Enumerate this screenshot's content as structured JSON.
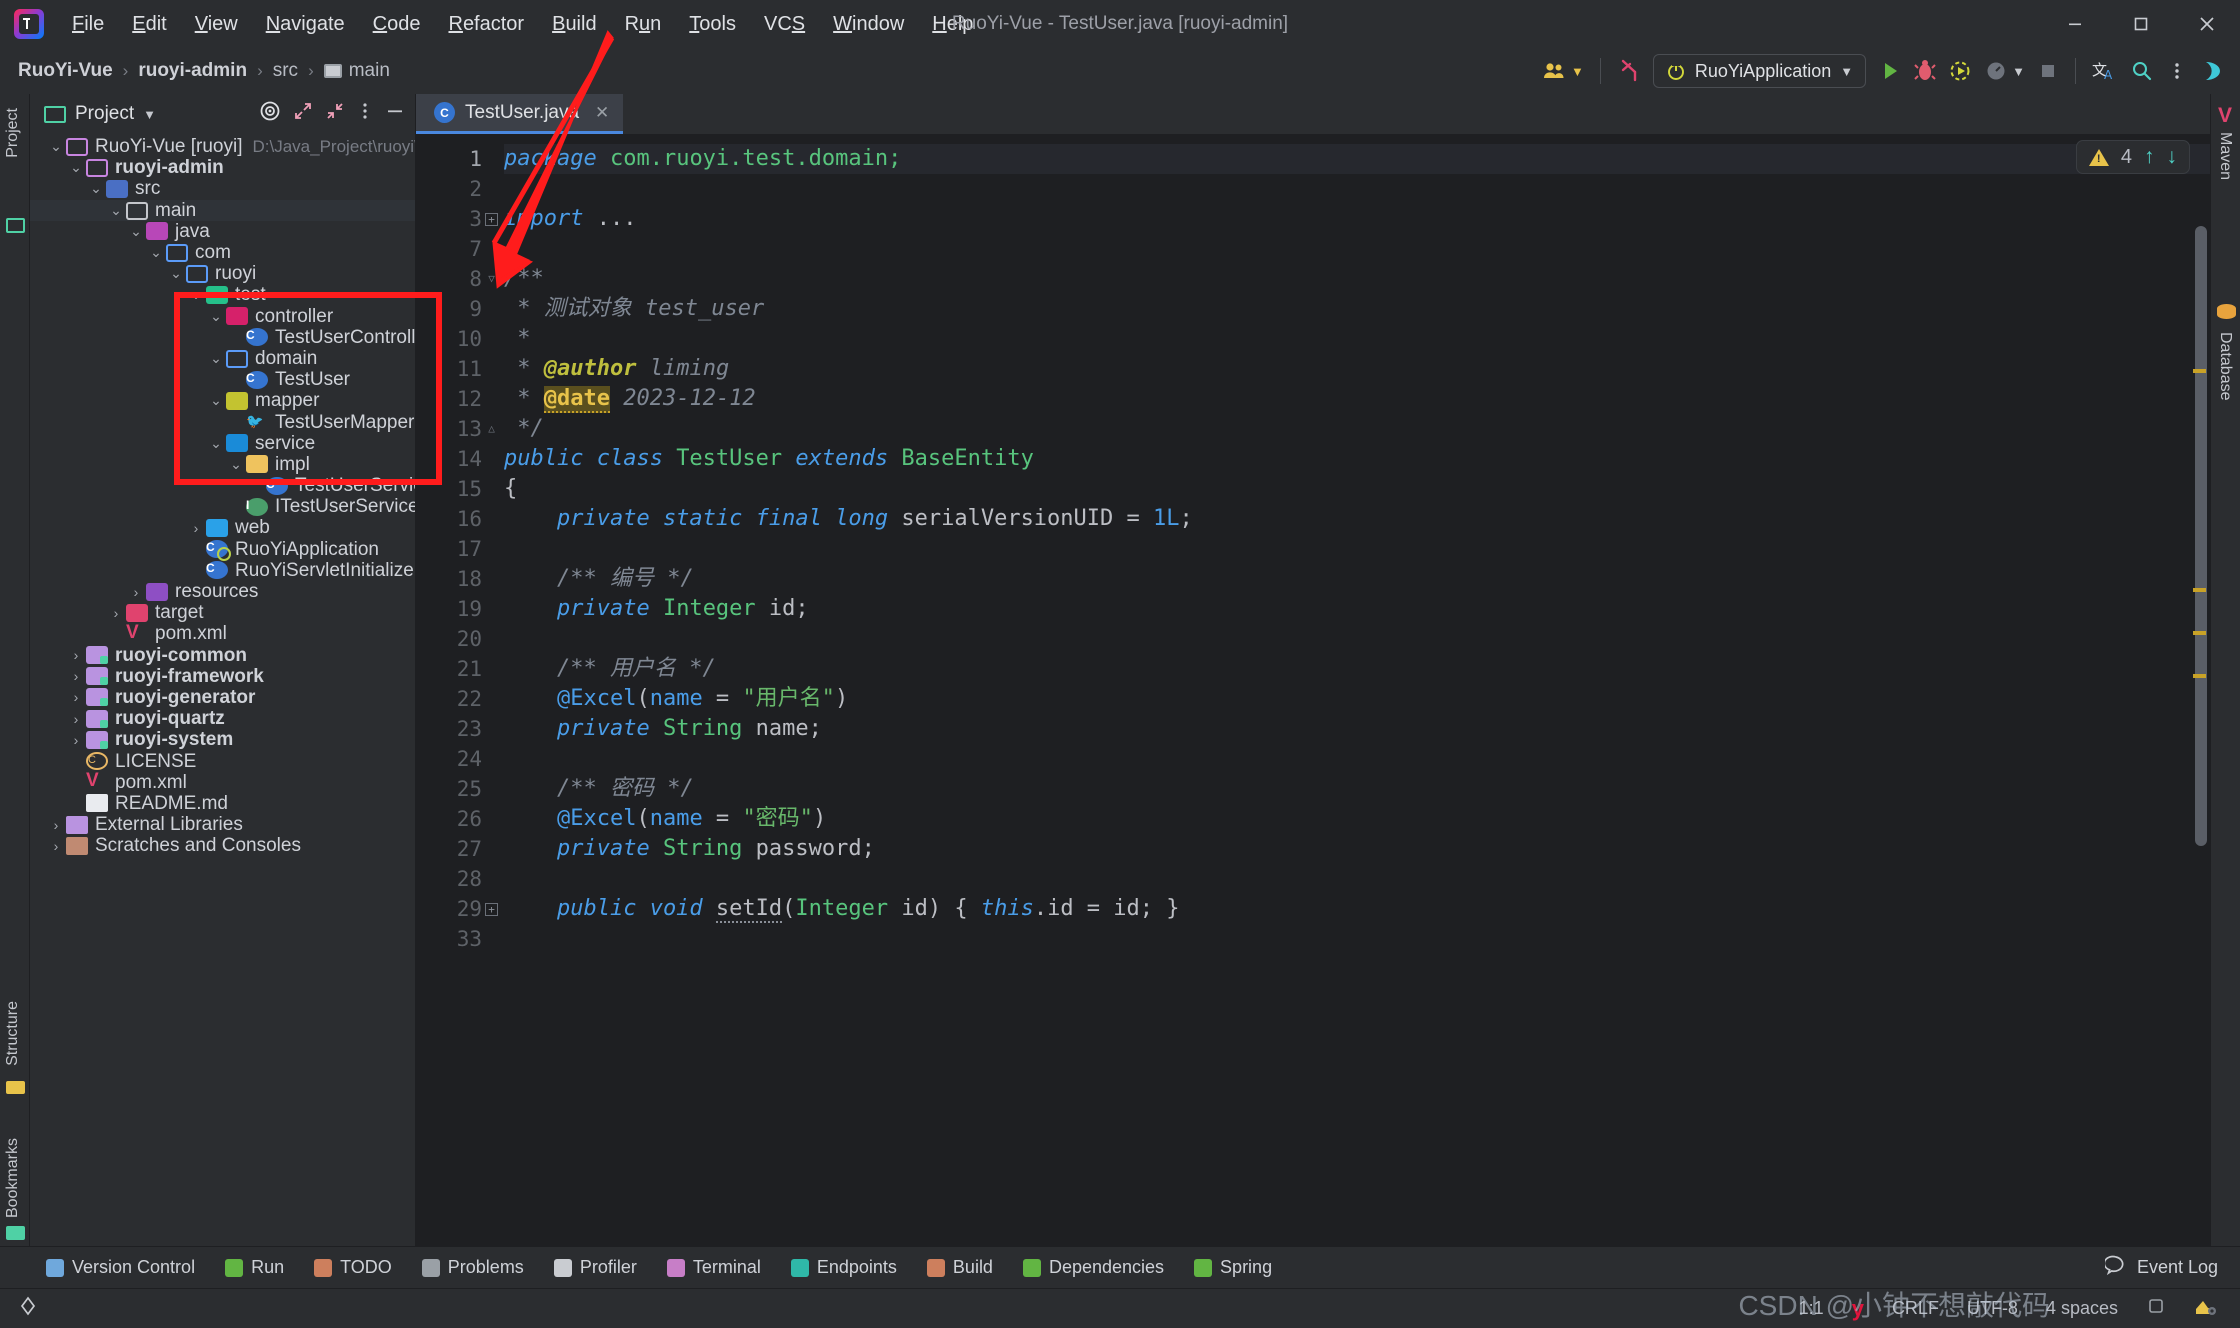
{
  "window": {
    "title": "RuoYi-Vue - TestUser.java [ruoyi-admin]",
    "app_icon": "intellij-idea-icon",
    "minimize": "–",
    "maximize": "❐",
    "close": "✕"
  },
  "menubar": {
    "items": [
      {
        "label": "File",
        "mnemonic": "F"
      },
      {
        "label": "Edit",
        "mnemonic": "E"
      },
      {
        "label": "View",
        "mnemonic": "V"
      },
      {
        "label": "Navigate",
        "mnemonic": "N"
      },
      {
        "label": "Code",
        "mnemonic": "C"
      },
      {
        "label": "Refactor",
        "mnemonic": "R"
      },
      {
        "label": "Build",
        "mnemonic": "B"
      },
      {
        "label": "Run",
        "mnemonic": "u"
      },
      {
        "label": "Tools",
        "mnemonic": "T"
      },
      {
        "label": "VCS",
        "mnemonic": "S"
      },
      {
        "label": "Window",
        "mnemonic": "W"
      },
      {
        "label": "Help",
        "mnemonic": "H"
      }
    ]
  },
  "navbar": {
    "breadcrumb": [
      "RuoYi-Vue",
      "ruoyi-admin",
      "src",
      "main"
    ],
    "run_config": "RuoYiApplication",
    "icons": [
      "users-icon",
      "chevron-down-icon",
      "vcs-branch-icon",
      "power-icon",
      "run-icon",
      "debug-icon",
      "run-coverage-icon",
      "profiler-icon",
      "stop-icon",
      "translate-icon",
      "search-icon",
      "more-vertical-icon",
      "ai-assistant-icon"
    ]
  },
  "left_rail": {
    "items": [
      "Project",
      "Structure",
      "Bookmarks"
    ]
  },
  "right_rail": {
    "items": [
      "Maven",
      "Database"
    ]
  },
  "project_panel": {
    "title": "Project",
    "header_icons": [
      "target-icon",
      "expand-icon",
      "collapse-icon",
      "more-vertical-icon",
      "hide-icon"
    ],
    "tree": [
      {
        "depth": 0,
        "arrow": "down",
        "icon": "folder-violet-icon",
        "label": "RuoYi-Vue [ruoyi]",
        "bold_part": "[ruoyi]",
        "path": "D:\\Java_Project\\ruoyi\\RuoYi-Vue",
        "selected": false
      },
      {
        "depth": 1,
        "arrow": "down",
        "icon": "folder-violet-icon",
        "label": "ruoyi-admin",
        "bold": true
      },
      {
        "depth": 2,
        "arrow": "down",
        "icon": "source-root-icon",
        "label": "src"
      },
      {
        "depth": 3,
        "arrow": "down",
        "icon": "folder-white-icon",
        "label": "main",
        "selected": true
      },
      {
        "depth": 4,
        "arrow": "down",
        "icon": "java-source-icon",
        "label": "java"
      },
      {
        "depth": 5,
        "arrow": "down",
        "icon": "folder-blue-icon",
        "label": "com"
      },
      {
        "depth": 6,
        "arrow": "down",
        "icon": "folder-blue-icon",
        "label": "ruoyi"
      },
      {
        "depth": 7,
        "arrow": "down",
        "icon": "test-package-icon",
        "label": "test"
      },
      {
        "depth": 8,
        "arrow": "down",
        "icon": "controller-package-icon",
        "label": "controller"
      },
      {
        "depth": 9,
        "arrow": "none",
        "icon": "java-class-icon",
        "label": "TestUserController"
      },
      {
        "depth": 8,
        "arrow": "down",
        "icon": "folder-blue-icon",
        "label": "domain"
      },
      {
        "depth": 9,
        "arrow": "none",
        "icon": "java-class-icon",
        "label": "TestUser"
      },
      {
        "depth": 8,
        "arrow": "down",
        "icon": "mapper-package-icon",
        "label": "mapper"
      },
      {
        "depth": 9,
        "arrow": "none",
        "icon": "mybatis-icon",
        "label": "TestUserMapper"
      },
      {
        "depth": 8,
        "arrow": "down",
        "icon": "service-package-icon",
        "label": "service"
      },
      {
        "depth": 9,
        "arrow": "down",
        "icon": "impl-package-icon",
        "label": "impl"
      },
      {
        "depth": 10,
        "arrow": "none",
        "icon": "java-class-icon",
        "label": "TestUserServiceImpl"
      },
      {
        "depth": 9,
        "arrow": "none",
        "icon": "java-interface-icon",
        "label": "ITestUserService"
      },
      {
        "depth": 7,
        "arrow": "right",
        "icon": "web-package-icon",
        "label": "web"
      },
      {
        "depth": 7,
        "arrow": "none",
        "icon": "spring-boot-app-icon",
        "label": "RuoYiApplication"
      },
      {
        "depth": 7,
        "arrow": "none",
        "icon": "java-class-icon",
        "label": "RuoYiServletInitializer"
      },
      {
        "depth": 4,
        "arrow": "right",
        "icon": "resources-root-icon",
        "label": "resources"
      },
      {
        "depth": 3,
        "arrow": "right",
        "icon": "target-folder-icon",
        "label": "target"
      },
      {
        "depth": 3,
        "arrow": "none",
        "icon": "maven-pom-icon",
        "label": "pom.xml"
      },
      {
        "depth": 1,
        "arrow": "right",
        "icon": "module-icon",
        "label": "ruoyi-common",
        "bold": true
      },
      {
        "depth": 1,
        "arrow": "right",
        "icon": "module-icon",
        "label": "ruoyi-framework",
        "bold": true
      },
      {
        "depth": 1,
        "arrow": "right",
        "icon": "module-icon",
        "label": "ruoyi-generator",
        "bold": true
      },
      {
        "depth": 1,
        "arrow": "right",
        "icon": "module-icon",
        "label": "ruoyi-quartz",
        "bold": true
      },
      {
        "depth": 1,
        "arrow": "right",
        "icon": "module-icon",
        "label": "ruoyi-system",
        "bold": true
      },
      {
        "depth": 1,
        "arrow": "none",
        "icon": "license-icon",
        "label": "LICENSE"
      },
      {
        "depth": 1,
        "arrow": "none",
        "icon": "maven-pom-icon",
        "label": "pom.xml"
      },
      {
        "depth": 1,
        "arrow": "none",
        "icon": "markdown-icon",
        "label": "README.md"
      },
      {
        "depth": 0,
        "arrow": "right",
        "icon": "external-libraries-icon",
        "label": "External Libraries"
      },
      {
        "depth": 0,
        "arrow": "right",
        "icon": "scratches-icon",
        "label": "Scratches and Consoles"
      }
    ]
  },
  "annotation": {
    "highlight_color": "#ff1c1c",
    "shape": "red-rectangle-around-test-package",
    "arrow": "red-arrow-pointing-to-test-package"
  },
  "editor": {
    "tab": {
      "label": "TestUser.java",
      "icon": "java-class-icon",
      "close": "✕"
    },
    "inspection": {
      "icon": "warning-triangle-icon",
      "count": "4",
      "up": "↑",
      "down": "↓"
    },
    "lines": [
      {
        "num": "1",
        "fold": "",
        "current": true,
        "tokens": [
          {
            "t": "package ",
            "c": "kw"
          },
          {
            "t": "com.ruoyi.test.domain;",
            "c": "typ"
          }
        ]
      },
      {
        "num": "2",
        "fold": "",
        "tokens": []
      },
      {
        "num": "3",
        "fold": "plus",
        "tokens": [
          {
            "t": "import ",
            "c": "kw"
          },
          {
            "t": "...",
            "c": "id"
          }
        ]
      },
      {
        "num": "7",
        "fold": "",
        "tokens": []
      },
      {
        "num": "8",
        "fold": "tri-down",
        "tokens": [
          {
            "t": "/**",
            "c": "cmt"
          }
        ]
      },
      {
        "num": "9",
        "fold": "",
        "tokens": [
          {
            "t": " * 测试对象 test_user",
            "c": "cmt"
          }
        ]
      },
      {
        "num": "10",
        "fold": "",
        "tokens": [
          {
            "t": " *",
            "c": "cmt"
          }
        ]
      },
      {
        "num": "11",
        "fold": "",
        "tokens": [
          {
            "t": " * ",
            "c": "cmt"
          },
          {
            "t": "@author",
            "c": "annob"
          },
          {
            "t": " liming",
            "c": "cmt"
          }
        ]
      },
      {
        "num": "12",
        "fold": "",
        "tokens": [
          {
            "t": " * ",
            "c": "cmt"
          },
          {
            "t": "@date",
            "c": "warnhl"
          },
          {
            "t": " 2023-12-12",
            "c": "cmt"
          }
        ]
      },
      {
        "num": "13",
        "fold": "tri-up",
        "tokens": [
          {
            "t": " */",
            "c": "cmt"
          }
        ]
      },
      {
        "num": "14",
        "fold": "",
        "tokens": [
          {
            "t": "public class ",
            "c": "kw"
          },
          {
            "t": "TestUser",
            "c": "typ"
          },
          {
            "t": " extends ",
            "c": "kw"
          },
          {
            "t": "BaseEntity",
            "c": "typ"
          }
        ]
      },
      {
        "num": "15",
        "fold": "",
        "tokens": [
          {
            "t": "{",
            "c": "id"
          }
        ]
      },
      {
        "num": "16",
        "fold": "",
        "tokens": [
          {
            "t": "    private static final long ",
            "c": "kw"
          },
          {
            "t": "serialVersionUID",
            "c": "id"
          },
          {
            "t": " = ",
            "c": "id"
          },
          {
            "t": "1L",
            "c": "num"
          },
          {
            "t": ";",
            "c": "id"
          }
        ]
      },
      {
        "num": "17",
        "fold": "",
        "tokens": []
      },
      {
        "num": "18",
        "fold": "",
        "tokens": [
          {
            "t": "    /** 编号 */",
            "c": "cmt"
          }
        ]
      },
      {
        "num": "19",
        "fold": "",
        "tokens": [
          {
            "t": "    private ",
            "c": "kw"
          },
          {
            "t": "Integer",
            "c": "typ"
          },
          {
            "t": " id;",
            "c": "id"
          }
        ]
      },
      {
        "num": "20",
        "fold": "",
        "tokens": []
      },
      {
        "num": "21",
        "fold": "",
        "tokens": [
          {
            "t": "    /** 用户名 */",
            "c": "cmt"
          }
        ]
      },
      {
        "num": "22",
        "fold": "",
        "tokens": [
          {
            "t": "    @Excel",
            "c": "kw2"
          },
          {
            "t": "(",
            "c": "id"
          },
          {
            "t": "name",
            "c": "kw2"
          },
          {
            "t": " = ",
            "c": "id"
          },
          {
            "t": "\"用户名\"",
            "c": "str"
          },
          {
            "t": ")",
            "c": "id"
          }
        ]
      },
      {
        "num": "23",
        "fold": "",
        "tokens": [
          {
            "t": "    private ",
            "c": "kw"
          },
          {
            "t": "String",
            "c": "typ"
          },
          {
            "t": " name;",
            "c": "id"
          }
        ]
      },
      {
        "num": "24",
        "fold": "",
        "tokens": []
      },
      {
        "num": "25",
        "fold": "",
        "tokens": [
          {
            "t": "    /** 密码 */",
            "c": "cmt"
          }
        ]
      },
      {
        "num": "26",
        "fold": "",
        "tokens": [
          {
            "t": "    @Excel",
            "c": "kw2"
          },
          {
            "t": "(",
            "c": "id"
          },
          {
            "t": "name",
            "c": "kw2"
          },
          {
            "t": " = ",
            "c": "id"
          },
          {
            "t": "\"密码\"",
            "c": "str"
          },
          {
            "t": ")",
            "c": "id"
          }
        ]
      },
      {
        "num": "27",
        "fold": "",
        "tokens": [
          {
            "t": "    private ",
            "c": "kw"
          },
          {
            "t": "String",
            "c": "typ"
          },
          {
            "t": " password;",
            "c": "id"
          }
        ]
      },
      {
        "num": "28",
        "fold": "",
        "tokens": []
      },
      {
        "num": "29",
        "fold": "plus",
        "tokens": [
          {
            "t": "    public void ",
            "c": "kw"
          },
          {
            "t": "setId",
            "c": "typo"
          },
          {
            "t": "(",
            "c": "id"
          },
          {
            "t": "Integer",
            "c": "typ"
          },
          {
            "t": " id) { ",
            "c": "id"
          },
          {
            "t": "this",
            "c": "kw"
          },
          {
            "t": ".id = id; }",
            "c": "id"
          }
        ]
      },
      {
        "num": "33",
        "fold": "",
        "tokens": []
      }
    ]
  },
  "bottom_tools": [
    {
      "label": "Version Control",
      "icon": "vcs-branch-icon",
      "color": "#6fa8dc"
    },
    {
      "label": "Run",
      "icon": "run-icon",
      "color": "#62b543"
    },
    {
      "label": "TODO",
      "icon": "todo-icon",
      "color": "#cd7f5d"
    },
    {
      "label": "Problems",
      "icon": "problems-icon",
      "color": "#9aa0a6"
    },
    {
      "label": "Profiler",
      "icon": "profiler-icon",
      "color": "#c9ccd1"
    },
    {
      "label": "Terminal",
      "icon": "terminal-icon",
      "color": "#c77ec7"
    },
    {
      "label": "Endpoints",
      "icon": "endpoints-icon",
      "color": "#2fb8a8"
    },
    {
      "label": "Build",
      "icon": "build-icon",
      "color": "#cd7f5d"
    },
    {
      "label": "Dependencies",
      "icon": "dependencies-icon",
      "color": "#62b543"
    },
    {
      "label": "Spring",
      "icon": "spring-icon",
      "color": "#62b543"
    }
  ],
  "event_log": {
    "label": "Event Log",
    "icon": "balloon-icon"
  },
  "statusbar": {
    "position": "1:1",
    "vcs_icon": "yarn-icon",
    "line_separator": "CRLF",
    "encoding": "UTF-8",
    "indent": "4 spaces",
    "lock_icon": "read-only-icon",
    "inspector_icon": "inspections-gear-icon"
  },
  "watermark": "CSDN @小钟不想敲代码"
}
